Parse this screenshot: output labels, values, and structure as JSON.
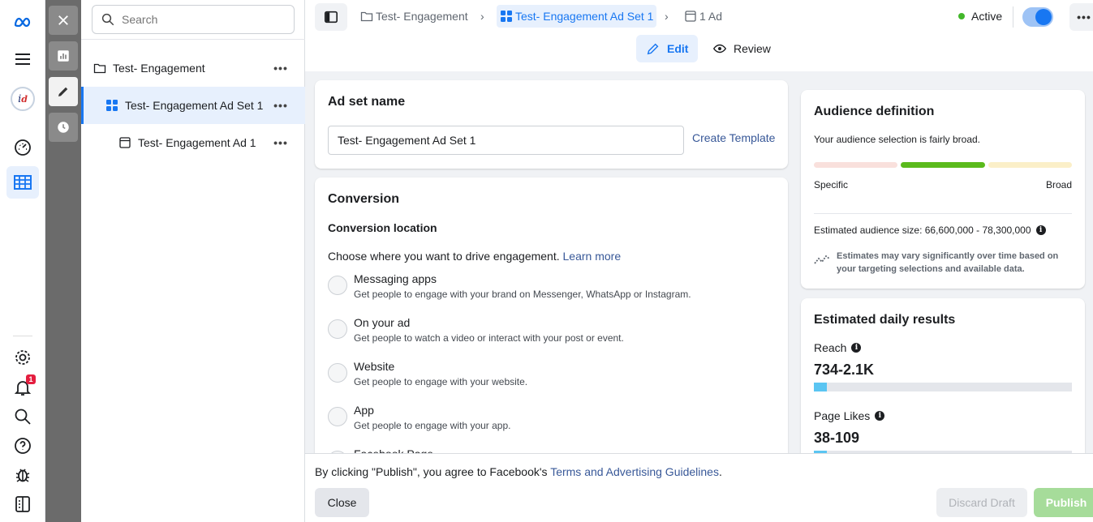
{
  "rail": {
    "logo_icon": "meta-logo-icon",
    "avatar_text": "i",
    "avatar_mark": "d",
    "notification_count": "1"
  },
  "tree": {
    "search_placeholder": "Search",
    "items": [
      {
        "label": "Test- Engagement",
        "icon": "folder-icon",
        "more": "•••"
      },
      {
        "label": "Test- Engagement Ad Set 1",
        "icon": "grid-icon",
        "more": "•••"
      },
      {
        "label": "Test- Engagement Ad 1",
        "icon": "ad-icon",
        "more": "•••"
      }
    ]
  },
  "topbar": {
    "breadcrumbs": [
      {
        "label": "Test- Engagement",
        "icon": "folder-icon"
      },
      {
        "label": "Test- Engagement Ad Set 1",
        "icon": "grid-icon"
      },
      {
        "label": "1 Ad",
        "icon": "ad-icon"
      }
    ],
    "chevron": "›",
    "status": "Active",
    "more": "•••",
    "tabs": {
      "edit": "Edit",
      "review": "Review"
    }
  },
  "adset": {
    "title": "Ad set name",
    "name_value": "Test- Engagement Ad Set 1",
    "create_template": "Create Template"
  },
  "conversion": {
    "title": "Conversion",
    "subtitle": "Conversion location",
    "description": "Choose where you want to drive engagement.",
    "learn_more": "Learn more",
    "options": [
      {
        "title": "Messaging apps",
        "desc": "Get people to engage with your brand on Messenger, WhatsApp or Instagram."
      },
      {
        "title": "On your ad",
        "desc": "Get people to watch a video or interact with your post or event."
      },
      {
        "title": "Website",
        "desc": "Get people to engage with your website."
      },
      {
        "title": "App",
        "desc": "Get people to engage with your app."
      },
      {
        "title": "Facebook Page",
        "desc": ""
      }
    ]
  },
  "audience": {
    "title": "Audience definition",
    "summary": "Your audience selection is fairly broad.",
    "specific_label": "Specific",
    "broad_label": "Broad",
    "size_text": "Estimated audience size: 66,600,000 - 78,300,000",
    "note": "Estimates may vary significantly over time based on your targeting selections and available data.",
    "colors": {
      "specific": "#f9e0dc",
      "current": "#5aba1c",
      "broad": "#fbefc8"
    }
  },
  "results": {
    "title": "Estimated daily results",
    "metrics": [
      {
        "label": "Reach",
        "value": "734-2.1K",
        "fill_fraction": 0.05
      },
      {
        "label": "Page Likes",
        "value": "38-109",
        "fill_fraction": 0.05
      }
    ]
  },
  "footer": {
    "agree_text": "By clicking \"Publish\", you agree to Facebook's",
    "terms_link": "Terms and Advertising Guidelines",
    "period": ".",
    "close": "Close",
    "discard": "Discard Draft",
    "publish": "Publish"
  }
}
